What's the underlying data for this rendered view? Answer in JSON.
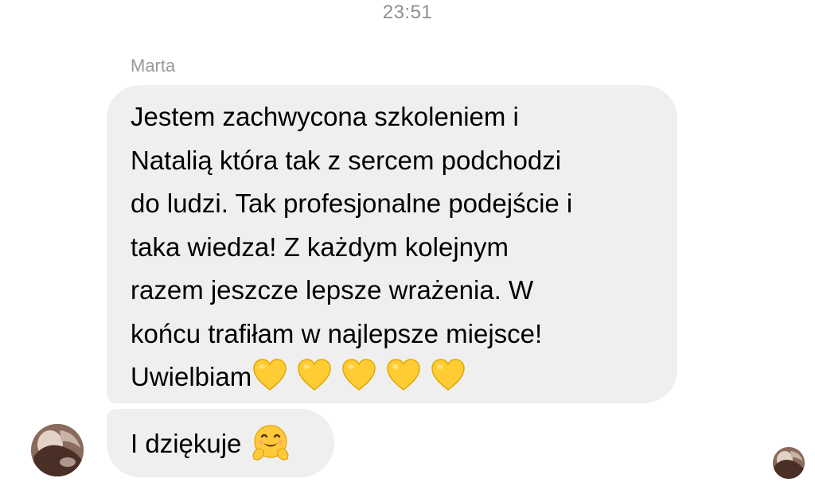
{
  "chat": {
    "timestamp": "23:51",
    "sender_name": "Marta",
    "message_lines": [
      "Jestem zachwycona szkoleniem i",
      "Natalią która tak z sercem podchodzi",
      "do ludzi. Tak profesjonalne podejście i",
      "taka wiedza!  Z każdym kolejnym",
      "razem jeszcze lepsze wrażenia. W",
      "końcu trafiłam w najlepsze miejsce!",
      "Uwielbiam"
    ],
    "message_emoji": [
      "yellow-heart",
      "yellow-heart",
      "yellow-heart",
      "yellow-heart",
      "yellow-heart"
    ],
    "second_message": "I dziękuje",
    "second_message_emoji": "hugging-face"
  },
  "colors": {
    "bubble": "#efeff0",
    "timestamp": "#8e8e93",
    "sender": "#9a9a9e",
    "heart": "#ffcc33"
  }
}
